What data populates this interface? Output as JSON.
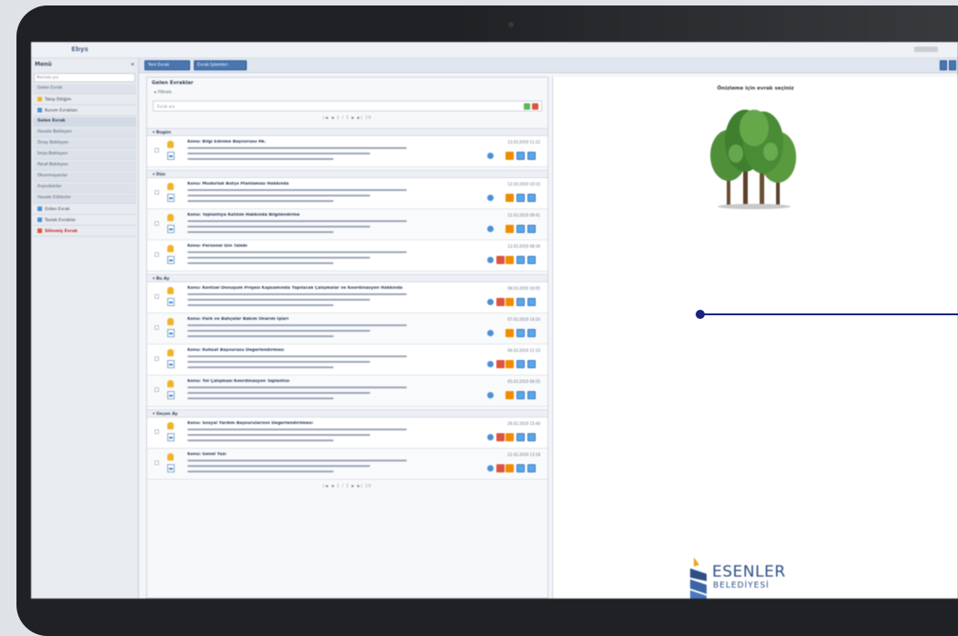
{
  "app": {
    "logo_text": "Ebys"
  },
  "sidebar": {
    "menu_label": "Menü",
    "chevron": "«",
    "search_placeholder": "Menüde ara",
    "items": [
      {
        "label": "Gelen Evrak",
        "style": "sub"
      },
      {
        "label": "Takip Ettiğim",
        "style": "plain",
        "icon": "#f0b429"
      },
      {
        "label": "Kurum Evrakları",
        "style": "plain",
        "icon": "#4a90d9"
      },
      {
        "label": "Gelen Evrak",
        "style": "hl"
      },
      {
        "label": "Havale Bekleyen",
        "style": "sub"
      },
      {
        "label": "Onay Bekleyen",
        "style": "sub"
      },
      {
        "label": "İmza Bekleyen",
        "style": "sub"
      },
      {
        "label": "Paraf Bekleyen",
        "style": "sub"
      },
      {
        "label": "Okunmayanlar",
        "style": "sub"
      },
      {
        "label": "Arşivdekiler",
        "style": "sub"
      },
      {
        "label": "Havale Edilenler",
        "style": "sub"
      },
      {
        "label": "Giden Evrak",
        "style": "plain",
        "icon": "#4a90d9"
      },
      {
        "label": "Taslak Evraklar",
        "style": "plain",
        "icon": "#4a90d9"
      },
      {
        "label": "Silinmiş Evrak",
        "style": "red",
        "icon": "#e0533d"
      }
    ]
  },
  "toolbar": {
    "buttons": [
      "Yeni Evrak",
      "Evrak İşlemleri"
    ]
  },
  "list": {
    "title": "Gelen Evraklar",
    "filter_label": "Filtrele",
    "search_placeholder": "Evrak ara",
    "pager": "|◀  ◀  1 / 1  ▶  ▶|  10",
    "groups": [
      {
        "name": "Bugün",
        "rows": [
          {
            "title": "Konu: Bilgi Edinme Başvurusu Hk.",
            "date": "13.03.2019 11:22",
            "lines": 3,
            "icons": [
              "pin",
              "stamp",
              "b1",
              "b2"
            ]
          }
        ]
      },
      {
        "name": "Dün",
        "rows": [
          {
            "title": "Konu: Müdürlük Bütçe Planlaması Hakkında",
            "date": "12.03.2019 10:15",
            "lines": 3,
            "icons": [
              "pin",
              "stamp",
              "b1",
              "b2"
            ]
          },
          {
            "title": "Konu: Toplantıya Katılım Hakkında Bilgilendirme",
            "date": "12.03.2019 09:41",
            "lines": 3,
            "icons": [
              "pin",
              "stamp",
              "b1",
              "b2"
            ]
          },
          {
            "title": "Konu: Personel İzin Talebi",
            "date": "12.03.2019 08:30",
            "lines": 3,
            "icons": [
              "pin",
              "book",
              "stamp",
              "b1",
              "b2"
            ]
          }
        ]
      },
      {
        "name": "Bu Ay",
        "rows": [
          {
            "title": "Konu: Kentsel Dönüşüm Projesi Kapsamında Yapılacak Çalışmalar ve Koordinasyon Hakkında",
            "date": "08.03.2019 16:05",
            "lines": 3,
            "icons": [
              "pin",
              "book",
              "stamp",
              "b1",
              "b2"
            ]
          },
          {
            "title": "Konu: Park ve Bahçeler Bakım Onarım İşleri",
            "date": "07.03.2019 14:20",
            "lines": 3,
            "icons": [
              "pin",
              "stamp",
              "b1",
              "b2"
            ]
          },
          {
            "title": "Konu: Ruhsat Başvurusu Değerlendirmesi",
            "date": "06.03.2019 11:10",
            "lines": 3,
            "icons": [
              "pin",
              "book",
              "stamp",
              "b1",
              "b2"
            ]
          },
          {
            "title": "Konu: Yol Çalışması Koordinasyon Toplantısı",
            "date": "05.03.2019 09:55",
            "lines": 3,
            "icons": [
              "pin",
              "stamp",
              "b1",
              "b2"
            ]
          }
        ]
      },
      {
        "name": "Geçen Ay",
        "rows": [
          {
            "title": "Konu: Sosyal Yardım Başvurularının Değerlendirilmesi",
            "date": "26.02.2019 15:40",
            "lines": 3,
            "icons": [
              "pin",
              "book",
              "stamp",
              "b1",
              "b2"
            ]
          },
          {
            "title": "Konu: Genel Yazı",
            "date": "22.02.2019 13:18",
            "lines": 3,
            "icons": [
              "pin",
              "book",
              "stamp",
              "b1",
              "b2"
            ]
          }
        ]
      }
    ]
  },
  "preview": {
    "title": "Önizleme için evrak seçiniz",
    "logo_line1": "ESENLER",
    "logo_line2": "BELEDİYESİ"
  },
  "colors": {
    "accent": "#4a76b0",
    "pointer": "#1a237e",
    "logo_blue": "#2e4f86",
    "logo_orange": "#f3a21f"
  }
}
